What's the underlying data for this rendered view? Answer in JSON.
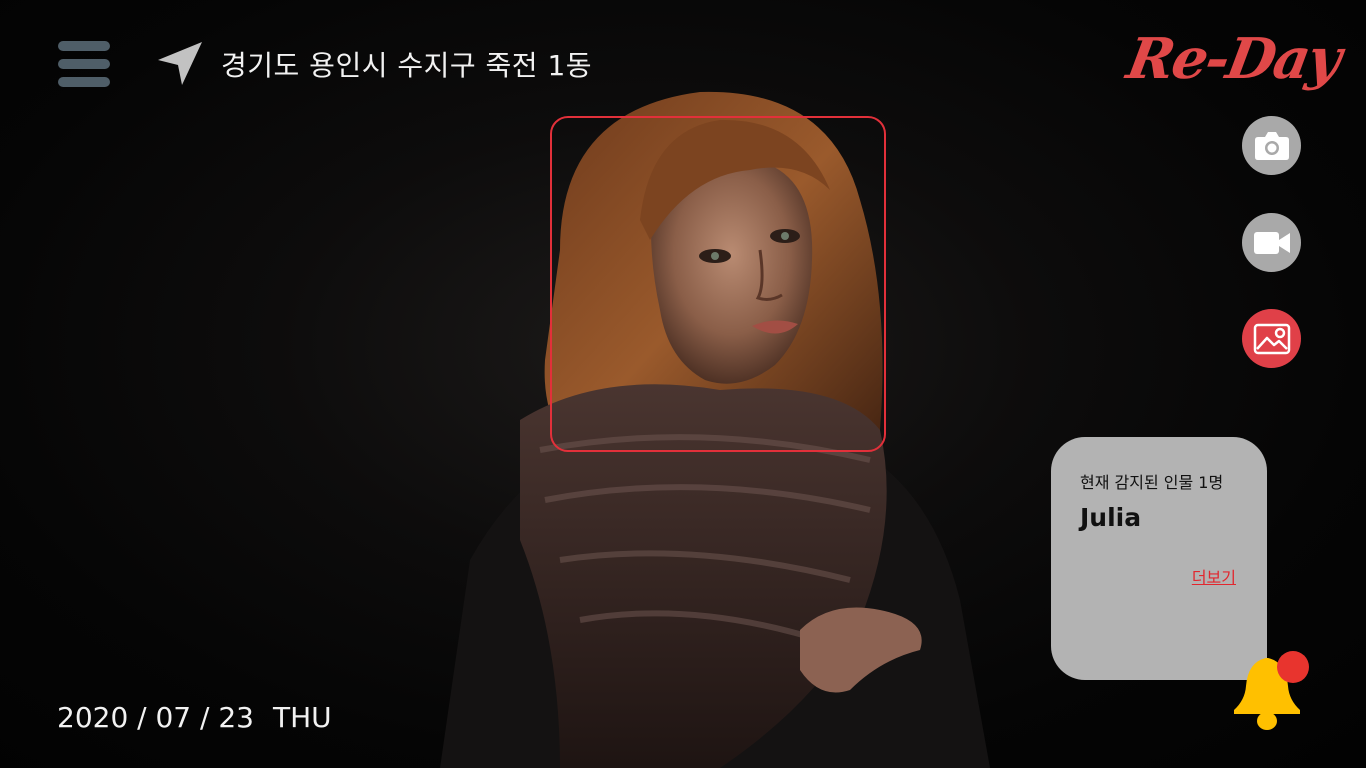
{
  "header": {
    "location": "경기도 용인시 수지구 죽전 1동",
    "logo": "Re-Day"
  },
  "actions": {
    "photo_icon": "camera-icon",
    "video_icon": "video-camera-icon",
    "gallery_icon": "image-gallery-icon"
  },
  "detection": {
    "title": "현재 감지된 인물 1명",
    "name": "Julia",
    "more_link": "더보기"
  },
  "footer": {
    "date": "2020 / 07 / 23",
    "day": "THU"
  },
  "colors": {
    "accent_red": "#e04048",
    "face_box": "#e2303a",
    "panel_bg": "#b3b3b3",
    "menu_icon": "#4f5e68",
    "bell": "#ffc000"
  }
}
